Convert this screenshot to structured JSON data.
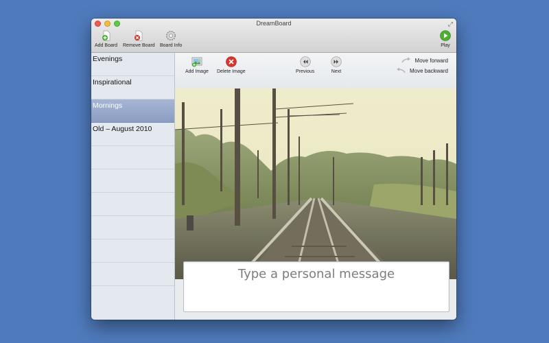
{
  "window": {
    "title": "DreamBoard"
  },
  "toolbar": {
    "add_board": "Add Board",
    "remove_board": "Remove Board",
    "board_info": "Board Info",
    "play": "Play"
  },
  "sidebar": {
    "items": [
      {
        "label": "Evenings",
        "selected": false
      },
      {
        "label": "Inspirational",
        "selected": false
      },
      {
        "label": "Mornings",
        "selected": true
      },
      {
        "label": "Old – August 2010",
        "selected": false
      }
    ]
  },
  "board_toolbar": {
    "add_image": "Add Image",
    "delete_image": "Delete Image",
    "previous": "Previous",
    "next": "Next",
    "move_forward": "Move forward",
    "move_backward": "Move backward"
  },
  "message": {
    "placeholder": "Type a personal message"
  },
  "colors": {
    "desktop": "#4f7bbd",
    "selection": "#93a4c8",
    "play_green": "#4caf2f",
    "delete_red": "#d9342b"
  },
  "icons": [
    "add-board-icon",
    "remove-board-icon",
    "board-info-icon",
    "play-icon",
    "add-image-icon",
    "delete-image-icon",
    "previous-icon",
    "next-icon",
    "move-forward-icon",
    "move-backward-icon"
  ]
}
